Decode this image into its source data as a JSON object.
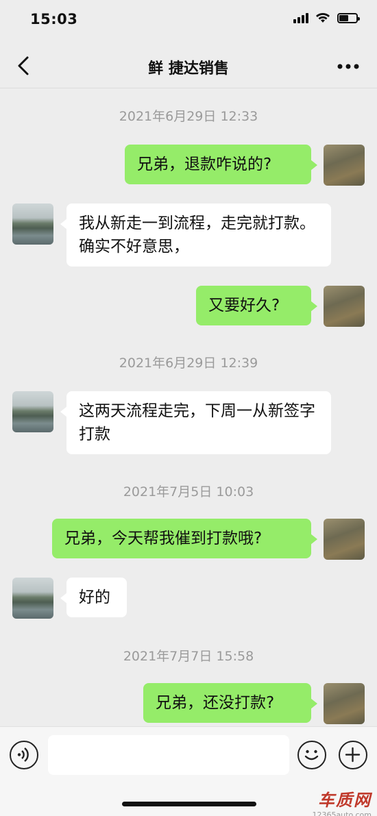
{
  "status_bar": {
    "time": "15:03"
  },
  "nav": {
    "title": "鲜 捷达销售"
  },
  "messages": [
    {
      "type": "timestamp",
      "text": "2021年6月29日 12:33"
    },
    {
      "type": "sent",
      "text": "兄弟，退款咋说的?"
    },
    {
      "type": "received",
      "text": "我从新走一到流程，走完就打款。确实不好意思，"
    },
    {
      "type": "sent",
      "text": "又要好久?"
    },
    {
      "type": "timestamp",
      "text": "2021年6月29日 12:39"
    },
    {
      "type": "received",
      "text": "这两天流程走完，下周一从新签字打款"
    },
    {
      "type": "timestamp",
      "text": "2021年7月5日 10:03"
    },
    {
      "type": "sent",
      "text": "兄弟，今天帮我催到打款哦?"
    },
    {
      "type": "received",
      "text": "好的"
    },
    {
      "type": "timestamp",
      "text": "2021年7月7日 15:58"
    },
    {
      "type": "sent",
      "text": "兄弟，还没打款?"
    }
  ],
  "input": {
    "value": "",
    "placeholder": ""
  },
  "watermark": {
    "main": "车质网",
    "sub": "12365auto.com"
  },
  "colors": {
    "sent_bubble": "#95ec69",
    "received_bubble": "#ffffff",
    "background": "#ededed"
  },
  "icons": [
    "signal-icon",
    "wifi-icon",
    "battery-icon",
    "back-chevron-icon",
    "more-dots-icon",
    "voice-icon",
    "emoji-icon",
    "plus-icon"
  ]
}
